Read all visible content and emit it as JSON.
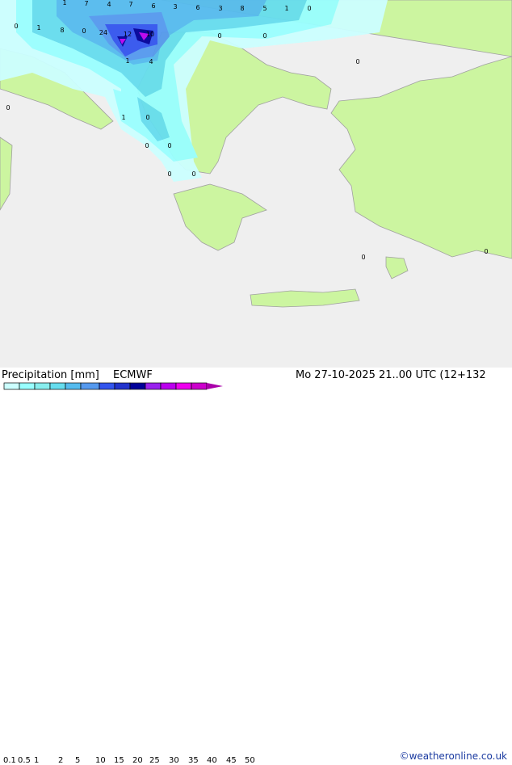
{
  "title": "Precipitation [mm]",
  "model": "ECMWF",
  "datetime": "Mo 27-10-2025 21..00 UTC (12+132",
  "copyright": "©weatheronline.co.uk",
  "legend": {
    "ticks": [
      "0.1",
      "0.5",
      "1",
      "2",
      "5",
      "10",
      "15",
      "20",
      "25",
      "30",
      "35",
      "40",
      "45",
      "50"
    ],
    "colors": [
      "#ccffff",
      "#99ffff",
      "#88eeee",
      "#66ddee",
      "#55bbee",
      "#5599ee",
      "#3355ee",
      "#2233cc",
      "#000099",
      "#9922ee",
      "#bb00ee",
      "#ee00ee",
      "#cc00cc"
    ]
  },
  "map_colors": {
    "land": "#ccf5a0",
    "sea": "#efefef",
    "border": "#a0a0a0"
  },
  "value_labels": [
    "1",
    "7",
    "4",
    "7",
    "6",
    "3",
    "6",
    "3",
    "8",
    "5",
    "1",
    "0",
    "0",
    "1",
    "8",
    "0",
    "24",
    "12",
    "10",
    "0",
    "0",
    "1",
    "4",
    "0",
    "0",
    "1",
    "0",
    "0",
    "0",
    "0",
    "0",
    "0",
    "0"
  ]
}
